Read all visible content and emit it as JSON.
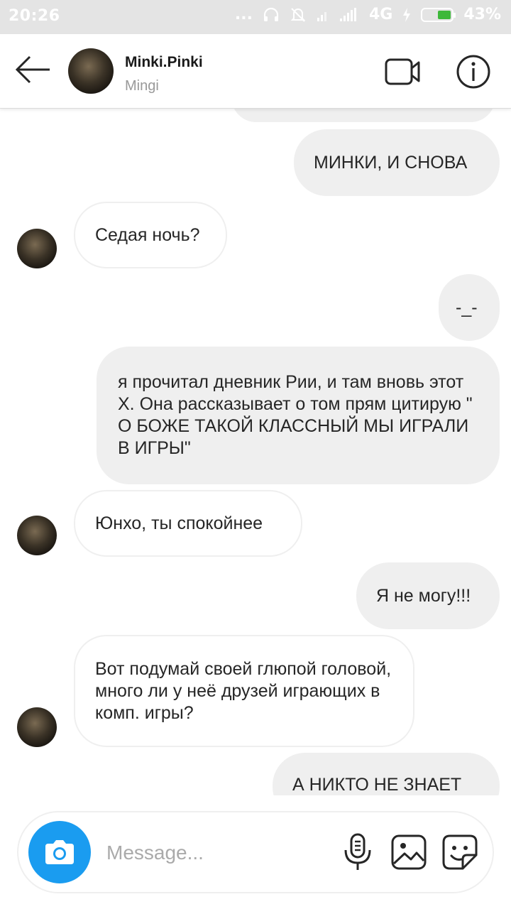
{
  "status_bar": {
    "time": "20:26",
    "dots": "...",
    "network": "4G",
    "battery": "43%"
  },
  "header": {
    "username": "Minki.Pinki",
    "subtitle": "Mingi",
    "icons": [
      "back-arrow-icon",
      "video-call-icon",
      "info-icon"
    ]
  },
  "messages": [
    {
      "side": "out",
      "text": "МИНКИ, И СНОВА"
    },
    {
      "side": "in",
      "text": "Седая ночь?"
    },
    {
      "side": "out",
      "text": "-_-"
    },
    {
      "side": "out",
      "text": "я прочитал дневник Рии, и там вновь этот Х. Она рассказывает о том прям цитирую \" О БОЖЕ ТАКОЙ КЛАССНЫЙ МЫ ИГРАЛИ В ИГРЫ\""
    },
    {
      "side": "in",
      "text": "Юнхо, ты спокойнее"
    },
    {
      "side": "out",
      "text": "Я не могу!!!"
    },
    {
      "side": "in",
      "text": "Вот подумай своей глюпой головой, много ли у неё друзей играющих в комп. игры?"
    },
    {
      "side": "out",
      "text": "А НИКТО НЕ ЗНАЕТ"
    }
  ],
  "composer": {
    "placeholder": "Message...",
    "icons": [
      "camera-icon",
      "microphone-icon",
      "gallery-icon",
      "sticker-icon"
    ]
  },
  "colors": {
    "accent": "#1a9cf0",
    "outgoing_bubble": "#efefef",
    "incoming_border": "#efefef",
    "battery_fill": "#3db83a"
  }
}
